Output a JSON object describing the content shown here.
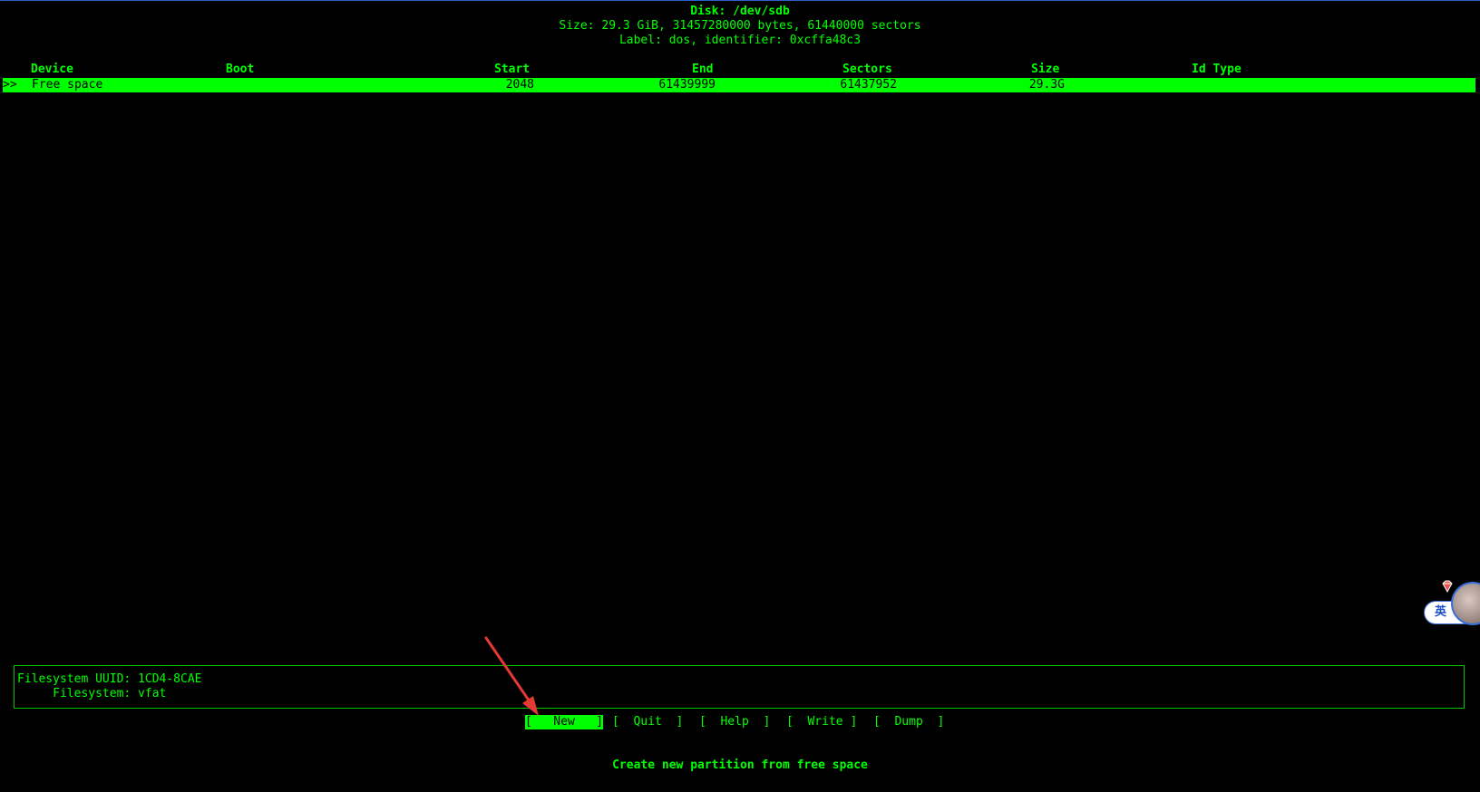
{
  "header": {
    "disk": "Disk: /dev/sdb",
    "size": "Size: 29.3 GiB, 31457280000 bytes, 61440000 sectors",
    "label": "Label: dos, identifier: 0xcffa48c3"
  },
  "table": {
    "columns": [
      "Device",
      "Boot",
      "Start",
      "End",
      "Sectors",
      "Size",
      "Id Type"
    ],
    "rows": [
      {
        "marker": ">>",
        "device": "Free space",
        "boot": "",
        "start": "2048",
        "end": "61439999",
        "sectors": "61437952",
        "size": "29.3G",
        "id_type": ""
      }
    ]
  },
  "info": {
    "uuid_line": "Filesystem UUID: 1CD4-8CAE",
    "fs_line": "     Filesystem: vfat"
  },
  "menu": [
    {
      "label": "[   New   ]",
      "selected": true
    },
    {
      "label": "[  Quit  ]",
      "selected": false
    },
    {
      "label": "[  Help  ]",
      "selected": false
    },
    {
      "label": "[  Write ]",
      "selected": false
    },
    {
      "label": "[  Dump  ]",
      "selected": false
    }
  ],
  "hint": "Create new partition from free space",
  "ime_widget": {
    "label": "英",
    "icons": [
      "gem-icon",
      "avatar-icon"
    ]
  },
  "colors": {
    "terminal_bg": "#000000",
    "terminal_fg": "#00ff00",
    "annotation_arrow": "#e53935"
  }
}
